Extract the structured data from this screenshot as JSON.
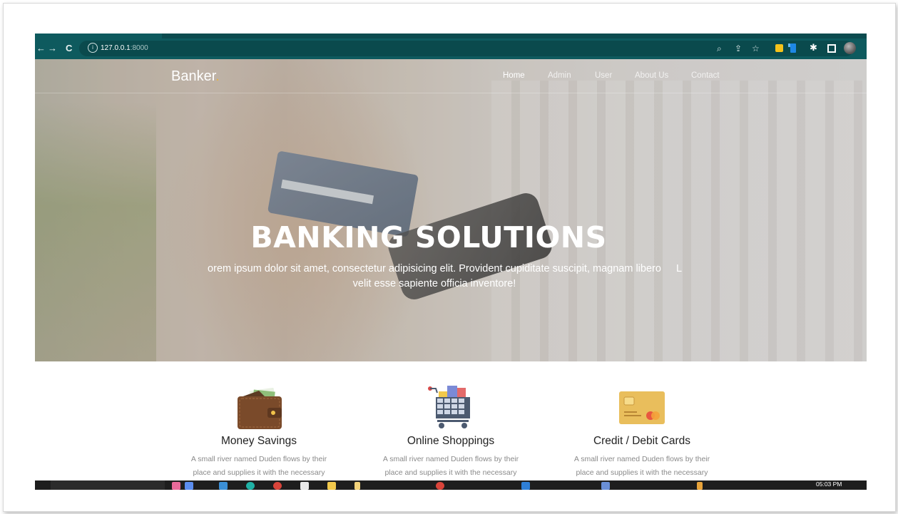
{
  "browser": {
    "url_host": "127.0.0.1",
    "url_port": ":8000",
    "icons": [
      "back-arrow-icon",
      "forward-arrow-icon",
      "reload-icon",
      "site-info-icon",
      "zoom-icon",
      "share-icon",
      "bookmark-star-icon",
      "extension-yellow-icon",
      "extension-blue-icon",
      "extensions-puzzle-icon",
      "side-panel-icon",
      "profile-avatar"
    ]
  },
  "site": {
    "brand": "Banker",
    "brand_dot": ".",
    "nav": [
      {
        "label": "Home"
      },
      {
        "label": "Admin"
      },
      {
        "label": "User"
      },
      {
        "label": "About Us"
      },
      {
        "label": "Contact"
      }
    ]
  },
  "hero": {
    "title": "BANKING SOLUTIONS",
    "subtitle": "orem ipsum dolor sit amet, consectetur adipisicing elit. Provident cupiditate suscipit, magnam libero velit esse sapiente officia inventore!",
    "stray_letter": "L",
    "slides": 3,
    "active_slide": 1
  },
  "features": [
    {
      "icon": "wallet-icon",
      "title": "Money Savings",
      "desc_line1": "A small river named Duden flows by their",
      "desc_line2": "place and supplies it with the necessary"
    },
    {
      "icon": "shopping-cart-icon",
      "title": "Online Shoppings",
      "desc_line1": "A small river named Duden flows by their",
      "desc_line2": "place and supplies it with the necessary"
    },
    {
      "icon": "credit-card-icon",
      "title": "Credit / Debit Cards",
      "desc_line1": "A small river named Duden flows by their",
      "desc_line2": "place and supplies it with the necessary"
    }
  ],
  "taskbar": {
    "time": "05:03 PM"
  },
  "colors": {
    "chrome": "#0e5a5e",
    "brand_dot": "#e7b54a",
    "taskbar": "#1e1e1e"
  }
}
